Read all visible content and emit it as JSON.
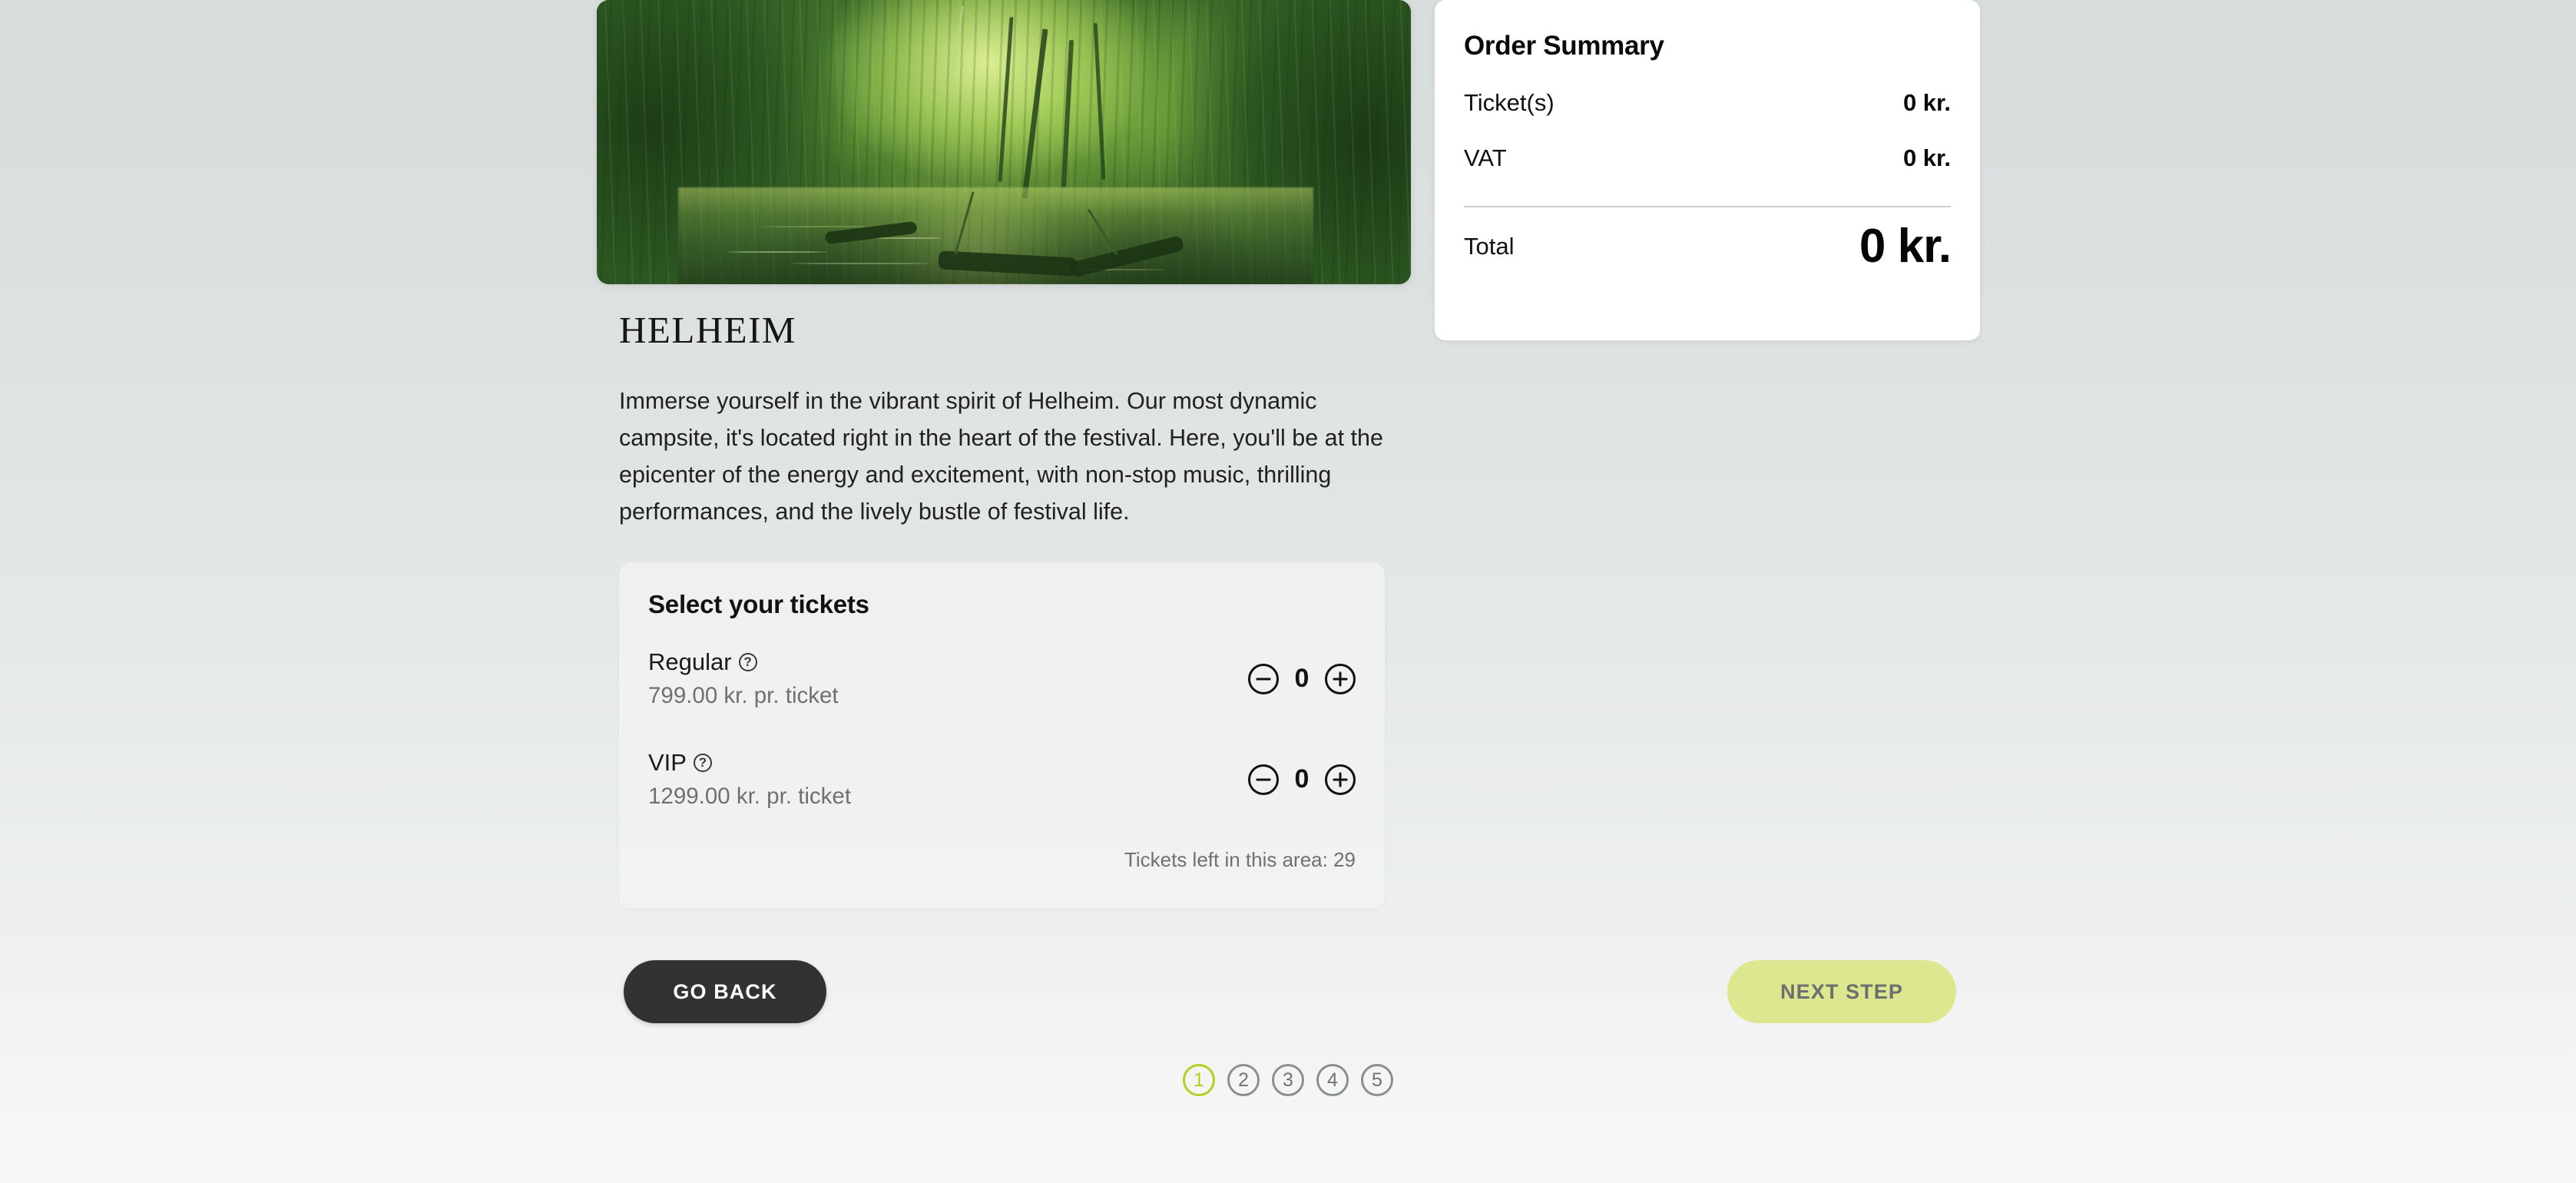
{
  "hero": {
    "alt": "lush green forest swamp with water channel"
  },
  "area": {
    "title": "HELHEIM",
    "description": "Immerse yourself in the vibrant spirit of Helheim. Our most dynamic campsite, it's located right in the heart of the festival. Here, you'll be at the epicenter of the energy and excitement, with non-stop music, thrilling performances, and the lively bustle of festival life."
  },
  "tickets": {
    "heading": "Select your tickets",
    "items": [
      {
        "name": "Regular",
        "price": "799.00 kr. pr. ticket",
        "quantity": "0",
        "help": "?",
        "minus": "−",
        "plus": "+"
      },
      {
        "name": "VIP",
        "price": "1299.00 kr. pr. ticket",
        "quantity": "0",
        "help": "?",
        "minus": "−",
        "plus": "+"
      }
    ],
    "tickets_left": "Tickets left in this area: 29"
  },
  "summary": {
    "title": "Order Summary",
    "rows": [
      {
        "label": "Ticket(s)",
        "value": "0 kr."
      },
      {
        "label": "VAT",
        "value": "0 kr."
      }
    ],
    "total_label": "Total",
    "total_value": "0 kr."
  },
  "actions": {
    "back_label": "GO BACK",
    "next_label": "NEXT STEP"
  },
  "steps": {
    "items": [
      {
        "label": "1",
        "active": true
      },
      {
        "label": "2",
        "active": false
      },
      {
        "label": "3",
        "active": false
      },
      {
        "label": "4",
        "active": false
      },
      {
        "label": "5",
        "active": false
      }
    ]
  },
  "colors": {
    "accent": "#b6ce1e",
    "next_button_bg": "#dce78f",
    "next_button_text": "#6e6e6e",
    "back_button_bg": "#323232",
    "page_bg_top": "#d8dddd",
    "page_bg_bottom": "#f7f7f7"
  }
}
